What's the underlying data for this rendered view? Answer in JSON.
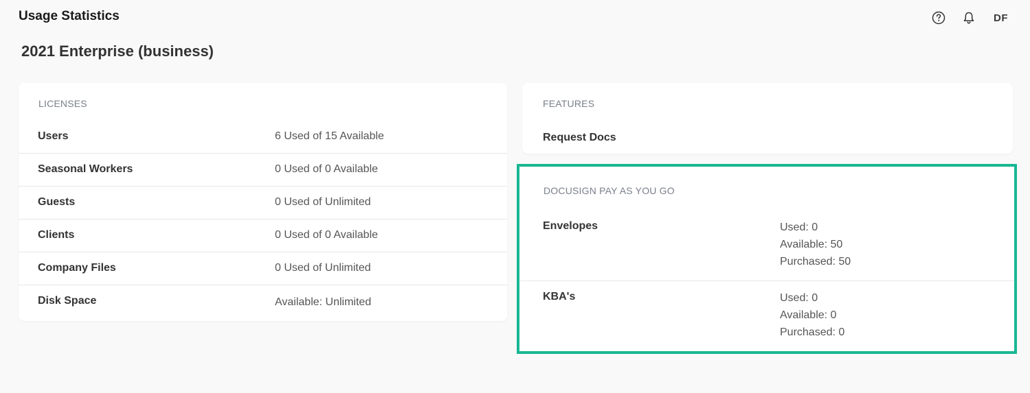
{
  "header": {
    "title": "Usage Statistics",
    "avatar_initials": "DF",
    "icons": [
      "help-icon",
      "bell-icon"
    ]
  },
  "page": {
    "title": "2021 Enterprise (business)"
  },
  "licenses": {
    "heading": "LICENSES",
    "rows": [
      {
        "label": "Users",
        "value": "6 Used of 15 Available"
      },
      {
        "label": "Seasonal Workers",
        "value": "0 Used of 0 Available"
      },
      {
        "label": "Guests",
        "value": "0 Used of Unlimited"
      },
      {
        "label": "Clients",
        "value": "0 Used of 0 Available"
      },
      {
        "label": "Company Files",
        "value": "0 Used of Unlimited"
      },
      {
        "label": "Disk Space",
        "value": "Available: Unlimited"
      }
    ]
  },
  "features": {
    "heading": "FEATURES",
    "items": [
      "Request Docs"
    ]
  },
  "payg": {
    "heading": "DOCUSIGN PAY AS YOU GO",
    "highlight_color": "#19b793",
    "rows": [
      {
        "label": "Envelopes",
        "used": "Used: 0",
        "available": "Available: 50",
        "purchased": "Purchased: 50"
      },
      {
        "label": "KBA's",
        "used": "Used: 0",
        "available": "Available: 0",
        "purchased": "Purchased: 0"
      }
    ]
  }
}
